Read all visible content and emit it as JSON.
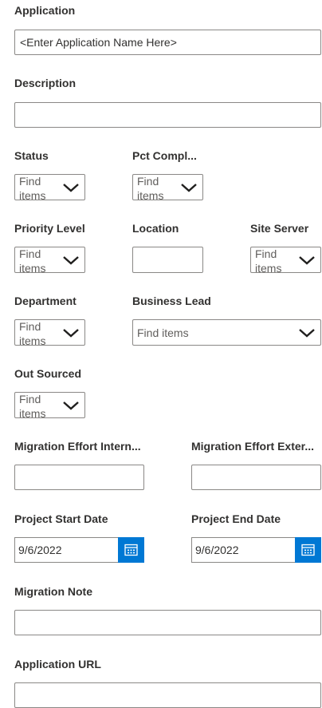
{
  "form": {
    "application": {
      "label": "Application",
      "value": "<Enter Application Name Here>"
    },
    "description": {
      "label": "Description",
      "value": ""
    },
    "status": {
      "label": "Status",
      "placeholder": "Find items"
    },
    "pct_complete": {
      "label": "Pct Compl...",
      "placeholder": "Find items"
    },
    "priority_level": {
      "label": "Priority Level",
      "placeholder": "Find items"
    },
    "location": {
      "label": "Location",
      "value": ""
    },
    "site_server": {
      "label": "Site Server",
      "placeholder": "Find items"
    },
    "department": {
      "label": "Department",
      "placeholder": "Find items"
    },
    "business_lead": {
      "label": "Business Lead",
      "placeholder": "Find items"
    },
    "out_sourced": {
      "label": "Out Sourced",
      "placeholder": "Find items"
    },
    "migration_effort_internal": {
      "label": "Migration Effort Intern...",
      "value": ""
    },
    "migration_effort_external": {
      "label": "Migration Effort Exter...",
      "value": ""
    },
    "project_start_date": {
      "label": "Project Start Date",
      "value": "9/6/2022"
    },
    "project_end_date": {
      "label": "Project End Date",
      "value": "9/6/2022"
    },
    "migration_note": {
      "label": "Migration Note",
      "value": ""
    },
    "application_url": {
      "label": "Application URL",
      "value": ""
    }
  },
  "icons": {
    "dropdown": "chevron-down-icon",
    "calendar": "calendar-icon"
  },
  "colors": {
    "accent": "#0078d4",
    "border": "#8a8886",
    "label_text": "#323130",
    "placeholder_text": "#605e5c"
  }
}
